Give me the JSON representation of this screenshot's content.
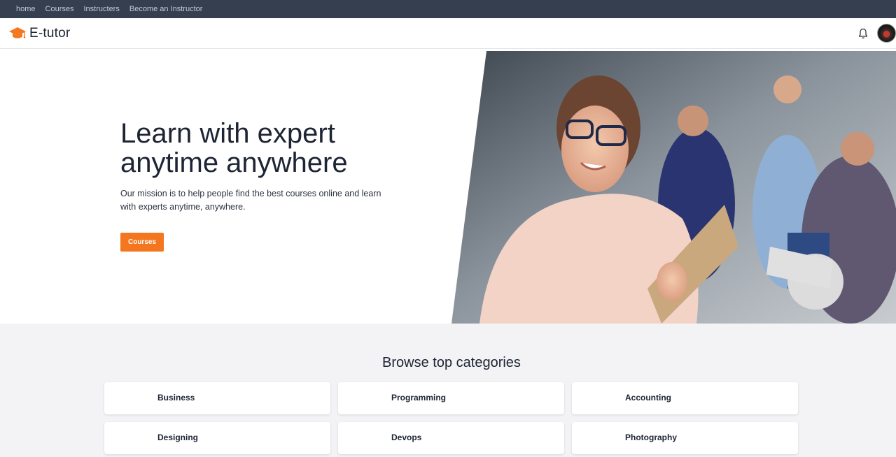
{
  "topnav": {
    "links": [
      "home",
      "Courses",
      "Instructers",
      "Become an Instructor"
    ]
  },
  "header": {
    "brand_name": "E-tutor",
    "brand_icon": "graduation-cap-icon",
    "notification_icon": "bell-icon"
  },
  "hero": {
    "title_line1": "Learn with expert",
    "title_line2": "anytime anywhere",
    "subtitle_line1": "Our mission is to help people find the best courses online and learn",
    "subtitle_line2": "with experts anytime, anywhere.",
    "cta_label": "Courses"
  },
  "categories": {
    "heading": "Browse top categories",
    "items": [
      "Business",
      "Programming",
      "Accounting",
      "Designing",
      "Devops",
      "Photography"
    ]
  },
  "colors": {
    "accent": "#f4761f",
    "topnav_bg": "#353f50",
    "text": "#1d2433"
  }
}
